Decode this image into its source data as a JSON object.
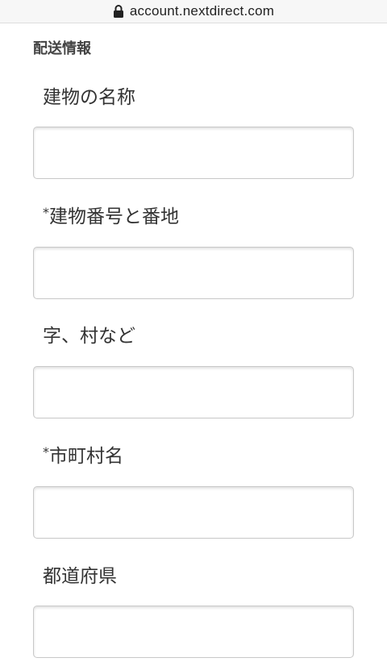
{
  "browser": {
    "url": "account.nextdirect.com"
  },
  "section": {
    "title": "配送情報"
  },
  "fields": {
    "building_name": {
      "label": "建物の名称",
      "required": false,
      "value": ""
    },
    "building_number": {
      "label": "建物番号と番地",
      "required_mark": "*",
      "value": ""
    },
    "area": {
      "label": "字、村など",
      "required": false,
      "value": ""
    },
    "city": {
      "label": "市町村名",
      "required_mark": "*",
      "value": ""
    },
    "prefecture": {
      "label": "都道府県",
      "required": false,
      "value": ""
    }
  },
  "icons": {
    "lock": "lock-icon"
  }
}
